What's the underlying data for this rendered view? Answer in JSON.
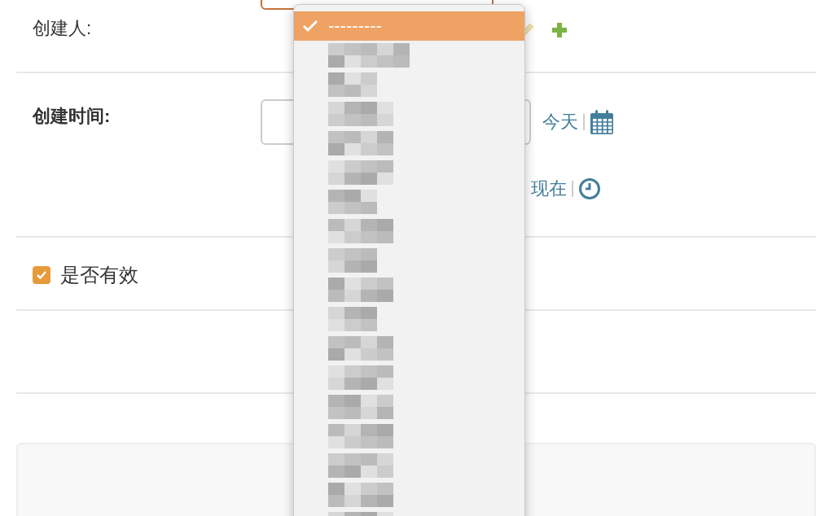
{
  "fields": [
    {
      "kind": "select",
      "label": "创建人:",
      "bold": false
    },
    {
      "kind": "datetime",
      "label": "创建时间:",
      "bold": true,
      "today_link": "今天",
      "now_link": "现在"
    },
    {
      "kind": "checkbox",
      "label": "是否有效",
      "checked": true
    },
    {
      "kind": "empty"
    }
  ],
  "dropdown": {
    "options": [
      {
        "kind": "text",
        "label": "---------",
        "selected": true
      },
      {
        "kind": "redacted",
        "selected": false
      },
      {
        "kind": "redacted",
        "selected": false
      },
      {
        "kind": "redacted",
        "selected": false
      },
      {
        "kind": "redacted",
        "selected": false
      },
      {
        "kind": "redacted",
        "selected": false
      },
      {
        "kind": "redacted",
        "selected": false
      },
      {
        "kind": "redacted",
        "selected": false
      },
      {
        "kind": "redacted",
        "selected": false
      },
      {
        "kind": "redacted",
        "selected": false
      },
      {
        "kind": "redacted",
        "selected": false
      },
      {
        "kind": "redacted",
        "selected": false
      },
      {
        "kind": "redacted",
        "selected": false
      },
      {
        "kind": "redacted",
        "selected": false
      },
      {
        "kind": "redacted",
        "selected": false
      },
      {
        "kind": "redacted",
        "selected": false
      },
      {
        "kind": "redacted",
        "selected": false
      },
      {
        "kind": "redacted",
        "selected": false
      }
    ]
  }
}
